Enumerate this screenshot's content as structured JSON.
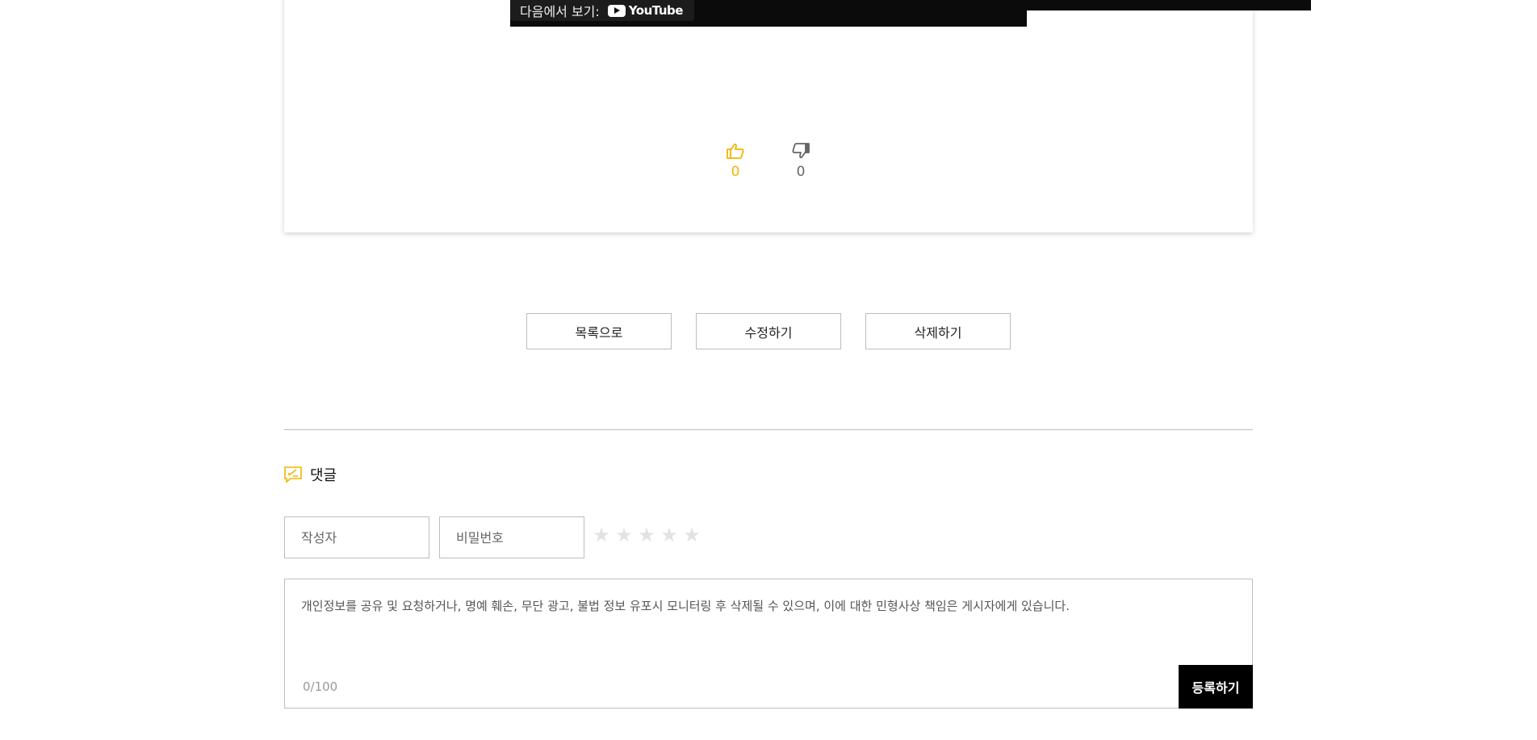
{
  "video": {
    "watch_on": "다음에서 보기:",
    "platform": "YouTube"
  },
  "votes": {
    "like_count": "0",
    "dislike_count": "0",
    "like_color": "#f4b400",
    "dislike_color": "#666666"
  },
  "actions": {
    "list": "목록으로",
    "edit": "수정하기",
    "delete": "삭제하기"
  },
  "comments": {
    "title": "댓글",
    "author_placeholder": "작성자",
    "password_placeholder": "비밀번호",
    "rating_max": 5,
    "rating_value": 0,
    "textarea_placeholder": "개인정보를 공유 및 요청하거나, 명예 훼손, 무단 광고, 불법 정보 유포시 모니터링 후 삭제될 수 있으며, 이에 대한 민형사상 책임은 게시자에게 있습니다.",
    "char_count": "0/100",
    "submit": "등록하기"
  },
  "colors": {
    "accent": "#f4b400",
    "submit_bg": "#000000"
  }
}
